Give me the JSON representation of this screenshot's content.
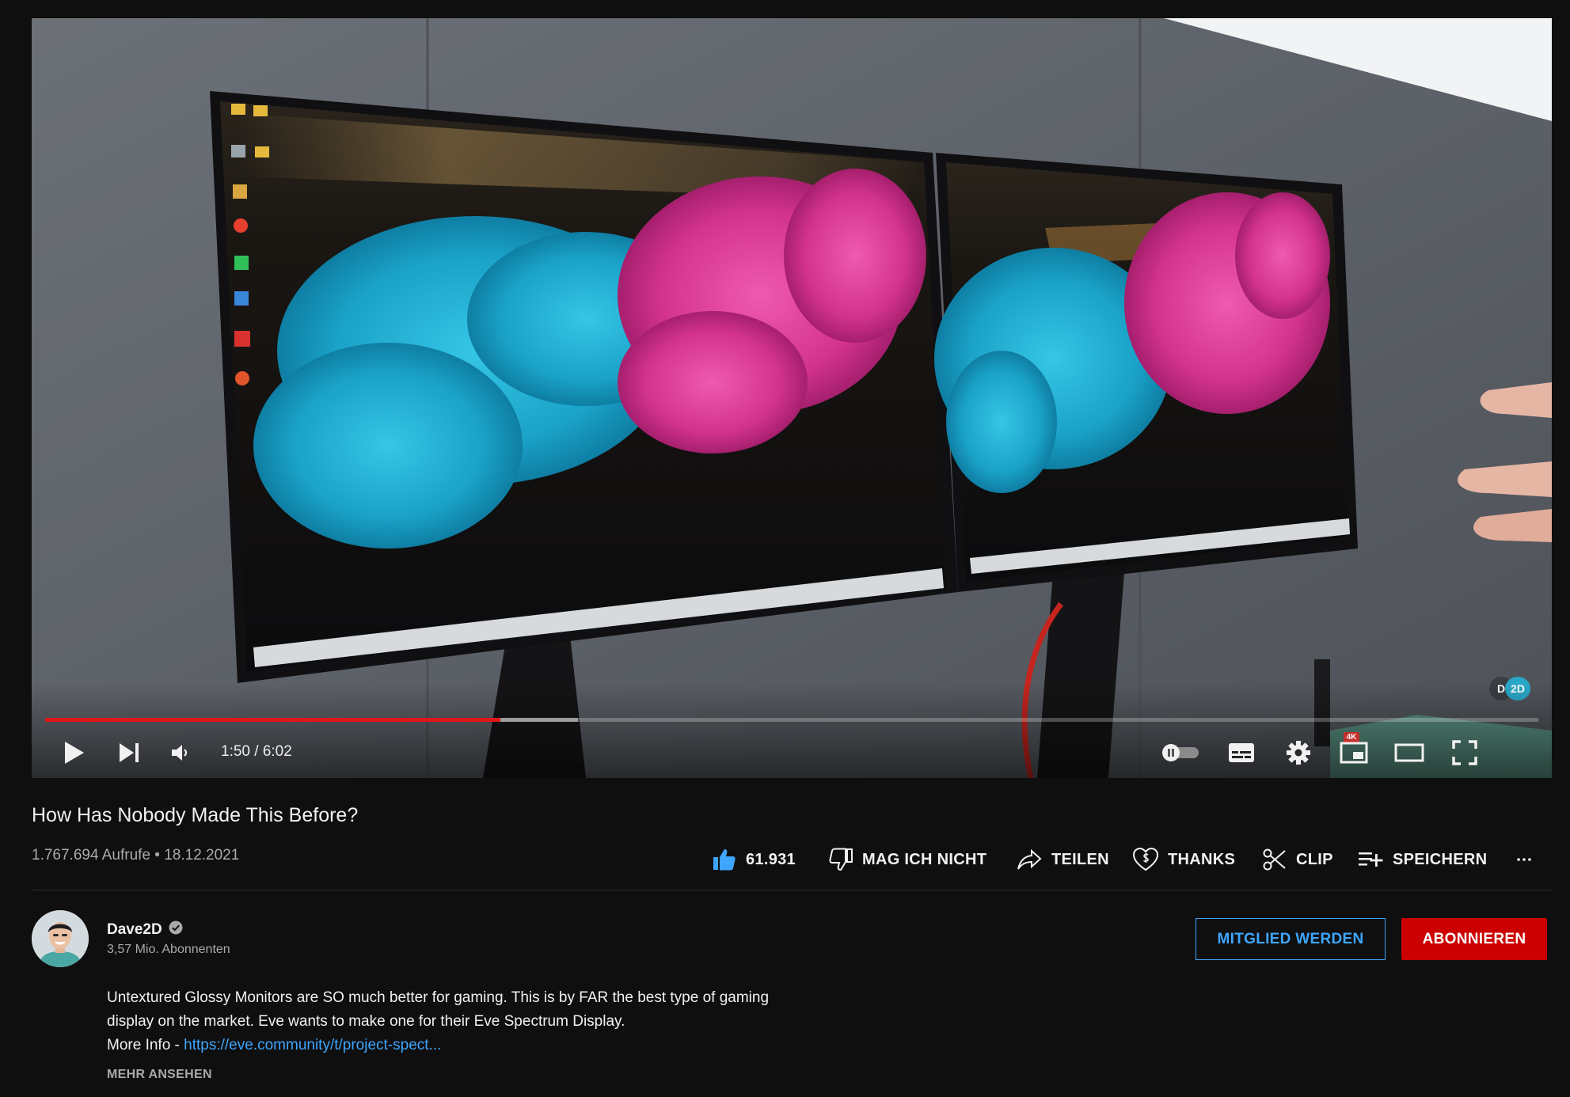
{
  "player": {
    "watermark_d": "D",
    "watermark_2d": "2D",
    "time_display": "1:50 / 6:02",
    "progress_played_fraction": 0.305,
    "progress_buffered_fraction": 0.357,
    "quality_badge": "4K",
    "icons": [
      "play-icon",
      "next-icon",
      "volume-icon",
      "autoplay-toggle-icon",
      "subtitles-icon",
      "settings-gear-icon",
      "miniplayer-icon",
      "theater-mode-icon",
      "fullscreen-icon"
    ]
  },
  "video": {
    "title": "How Has Nobody Made This Before?",
    "meta": "1.767.694 Aufrufe • 18.12.2021"
  },
  "actions": {
    "like_count": "61.931",
    "dislike_label": "MAG ICH NICHT",
    "share_label": "TEILEN",
    "thanks_label": "THANKS",
    "clip_label": "CLIP",
    "save_label": "SPEICHERN",
    "more_label": "..."
  },
  "channel": {
    "name": "Dave2D",
    "subscribers": "3,57 Mio. Abonnenten",
    "join_label": "MITGLIED WERDEN",
    "subscribe_label": "ABONNIEREN"
  },
  "description": {
    "line1": "Untextured Glossy Monitors are SO much better for gaming. This is by FAR the best type of gaming",
    "line2": "display on the market. Eve wants to make one for their Eve Spectrum Display.",
    "line3_prefix": "More Info - ",
    "line3_link": "https://eve.community/t/project-spect...",
    "show_more": "MEHR ANSEHEN"
  },
  "colors": {
    "background": "#0f0f0f",
    "accent_blue": "#3ea6ff",
    "subscribe_red": "#cc0000",
    "progress_red": "#e0161c",
    "like_blue": "#3ea6ff"
  }
}
